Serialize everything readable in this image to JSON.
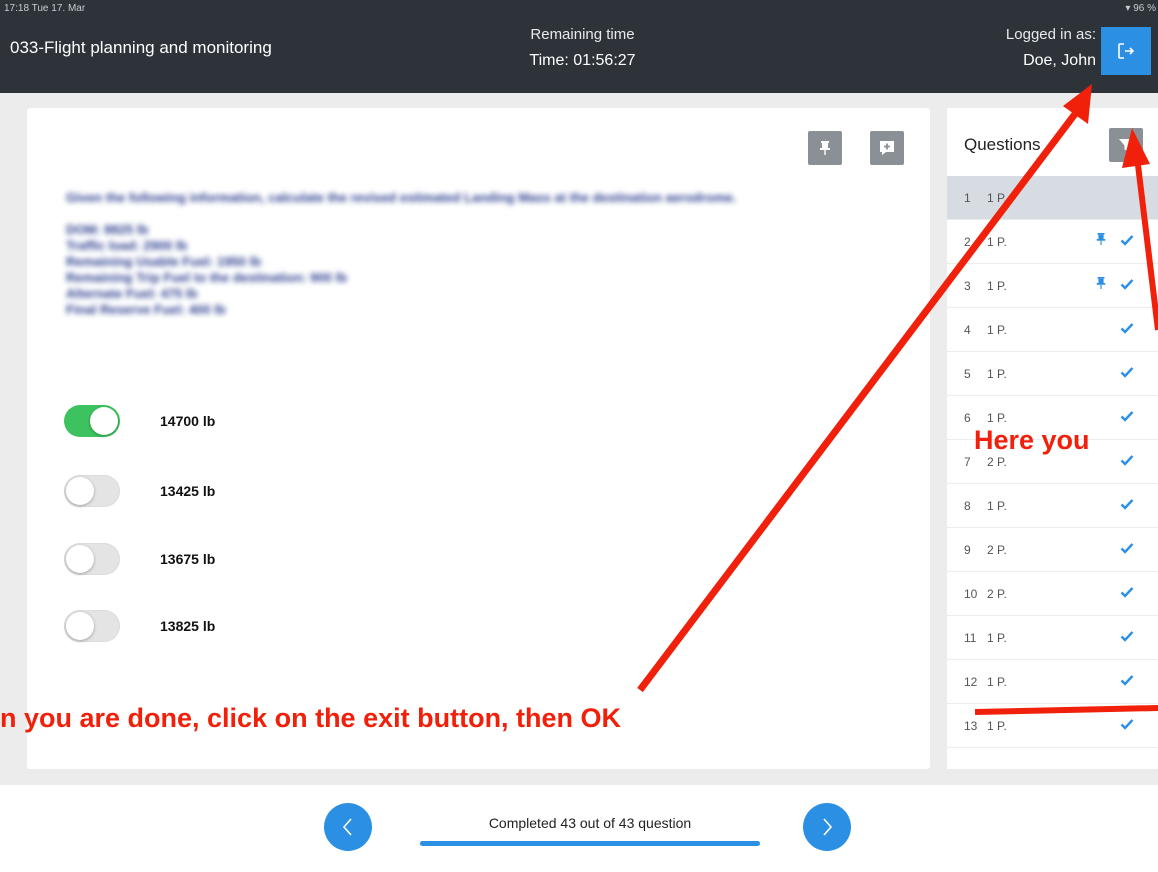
{
  "status_bar": {
    "time_date": "17:18  Tue 17. Mar",
    "battery": "96 %"
  },
  "header": {
    "subject": "033-Flight planning and monitoring",
    "remaining_label": "Remaining time",
    "timer": "Time: 01:56:27",
    "logged_label": "Logged in as:",
    "user": "Doe, John",
    "exit_icon": "exit-icon"
  },
  "question": {
    "intro": "Given the following information, calculate the revised estimated Landing Mass at the destination aerodrome.",
    "details": [
      "DOM: 8825 lb",
      "Traffic load: 2900 lb",
      "Remaining Usable Fuel: 1950 lb",
      "Remaining Trip Fuel to the destination: 900 lb",
      "Alternate Fuel: 475 lb",
      "Final Reserve Fuel: 400 lb"
    ],
    "answers": [
      {
        "label": "14700 lb",
        "selected": true
      },
      {
        "label": "13425 lb",
        "selected": false
      },
      {
        "label": "13675 lb",
        "selected": false
      },
      {
        "label": "13825 lb",
        "selected": false
      }
    ],
    "toolbar_icons": [
      "pin-icon",
      "add-comment-icon"
    ]
  },
  "sidebar": {
    "title": "Questions",
    "filter_icon": "filter-icon",
    "items": [
      {
        "num": "1",
        "points": "1 P.",
        "pinned": false,
        "answered": false,
        "current": true
      },
      {
        "num": "2",
        "points": "1 P.",
        "pinned": true,
        "answered": true
      },
      {
        "num": "3",
        "points": "1 P.",
        "pinned": true,
        "answered": true
      },
      {
        "num": "4",
        "points": "1 P.",
        "pinned": false,
        "answered": true
      },
      {
        "num": "5",
        "points": "1 P.",
        "pinned": false,
        "answered": true
      },
      {
        "num": "6",
        "points": "1 P.",
        "pinned": false,
        "answered": true
      },
      {
        "num": "7",
        "points": "2 P.",
        "pinned": false,
        "answered": true
      },
      {
        "num": "8",
        "points": "1 P.",
        "pinned": false,
        "answered": true
      },
      {
        "num": "9",
        "points": "2 P.",
        "pinned": false,
        "answered": true
      },
      {
        "num": "10",
        "points": "2 P.",
        "pinned": false,
        "answered": true
      },
      {
        "num": "11",
        "points": "1 P.",
        "pinned": false,
        "answered": true
      },
      {
        "num": "12",
        "points": "1 P.",
        "pinned": false,
        "answered": true
      },
      {
        "num": "13",
        "points": "1 P.",
        "pinned": false,
        "answered": true
      }
    ]
  },
  "footer": {
    "progress_text": "Completed 43 out of 43 question",
    "progress_fraction": 1.0,
    "prev_icon": "chevron-left-icon",
    "next_icon": "chevron-right-icon"
  },
  "annotations": {
    "bottom": "n you are done, click on the exit button, then OK",
    "right": "Here you"
  },
  "colors": {
    "accent": "#2b8fe3",
    "header_bg": "#2d3339",
    "toggle_on": "#3cc35f",
    "annotation": "#f0200a",
    "question_text": "#2c3f8e"
  }
}
